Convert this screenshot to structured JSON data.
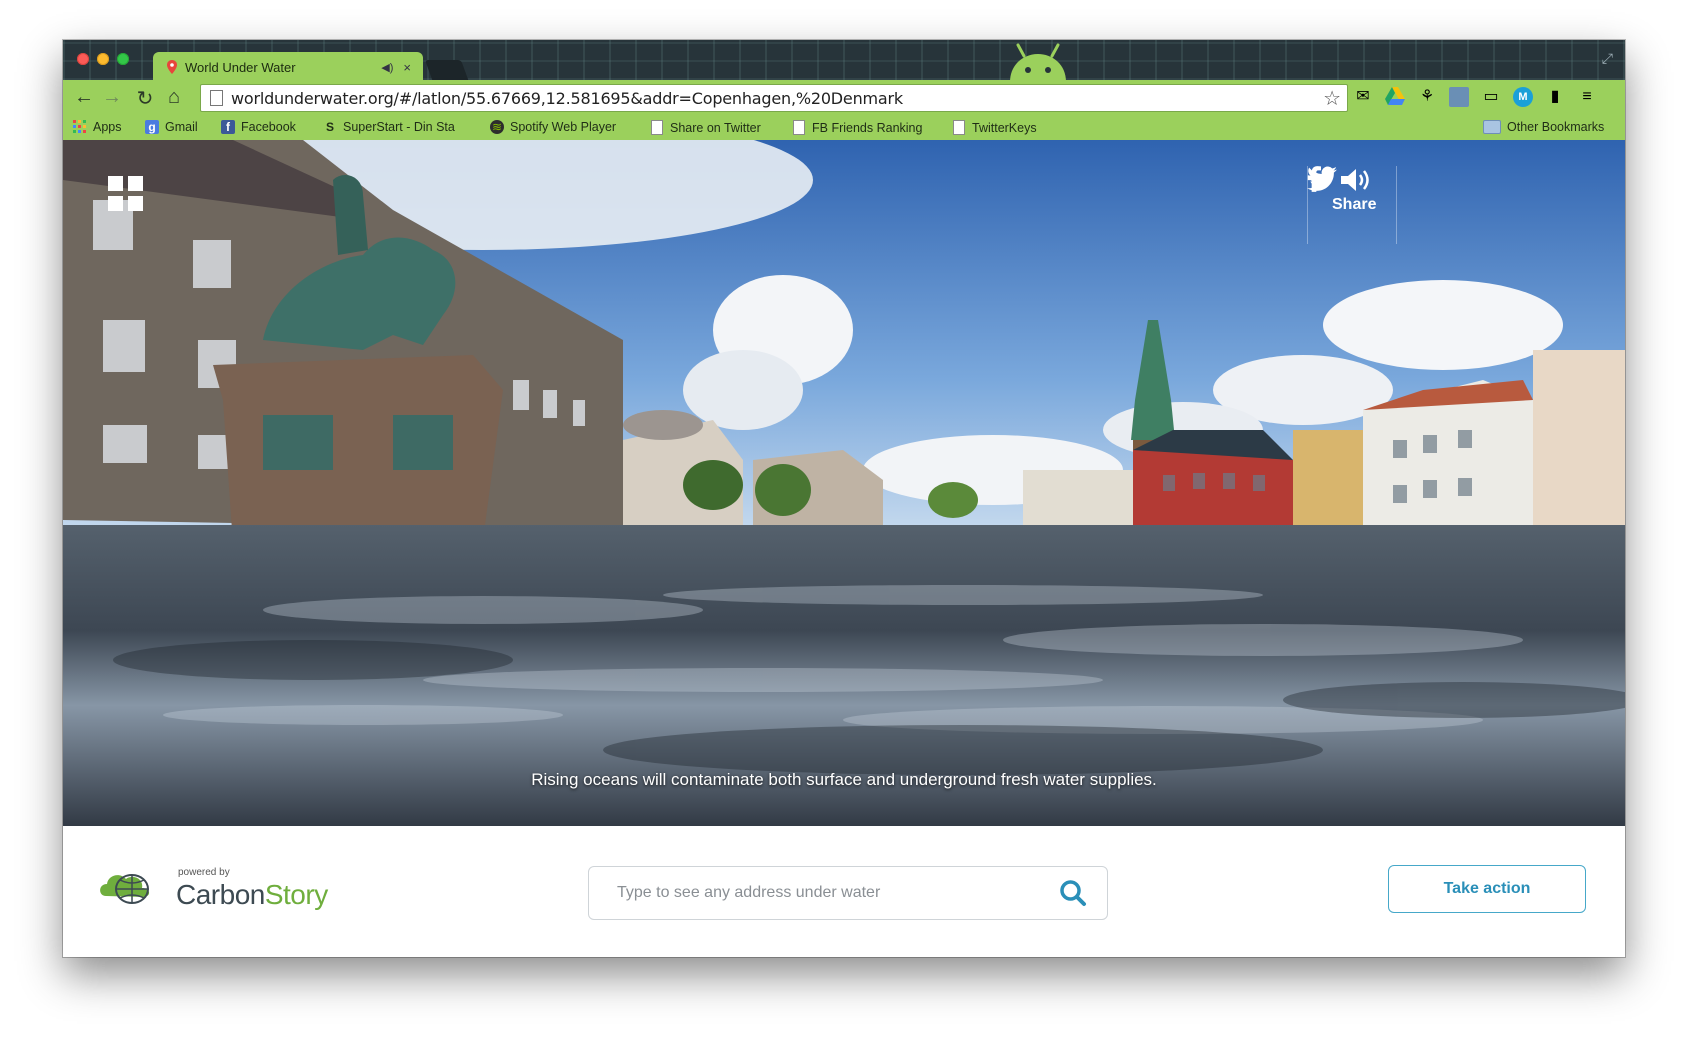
{
  "browser": {
    "tab_title": "World Under Water",
    "tab_close": "×",
    "url": "worldunderwater.org/#/latlon/55.67669,12.581695&addr=Copenhagen,%20Denmark",
    "bookmarks": [
      {
        "label": "Apps"
      },
      {
        "label": "Gmail"
      },
      {
        "label": "Facebook"
      },
      {
        "label": "SuperStart - Din Sta"
      },
      {
        "label": "Spotify Web Player"
      },
      {
        "label": "Share on Twitter"
      },
      {
        "label": "FB Friends Ranking"
      },
      {
        "label": "TwitterKeys"
      }
    ],
    "other_bookmarks": "Other Bookmarks"
  },
  "scene": {
    "share_label": "Share",
    "caption": "Rising oceans will contaminate both surface and underground fresh water supplies."
  },
  "footer": {
    "powered_by": "powered by",
    "brand_carbon": "Carbon",
    "brand_story": "Story",
    "search_placeholder": "Type to see any address under water",
    "take_action": "Take action"
  },
  "colors": {
    "chrome_green": "#9bd05c",
    "brand_green": "#6fae3d",
    "accent_blue": "#2a8fb8"
  }
}
